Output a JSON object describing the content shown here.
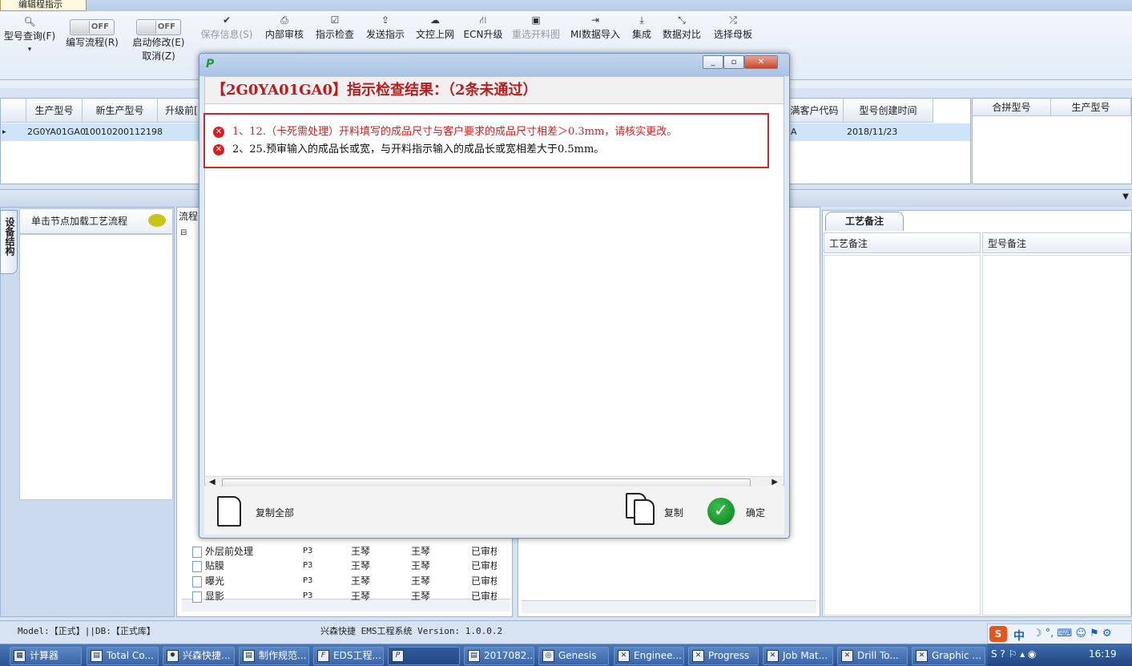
{
  "doc_tab": {
    "label": "编辑程指示"
  },
  "toolbar": {
    "search": {
      "icon": "search-icon",
      "label": "型号查询(F)"
    },
    "edit_flow": {
      "toggle": "OFF",
      "label": "编写流程(R)"
    },
    "enable_edit": {
      "toggle": "OFF",
      "label": "启动修改(E)",
      "cancel": "取消(Z)"
    },
    "items": [
      {
        "icon": "check-icon",
        "label": "保存信息(S)",
        "disabled": true
      },
      {
        "icon": "print-icon",
        "label": "内部审核"
      },
      {
        "icon": "checkbox-icon",
        "label": "指示检查"
      },
      {
        "icon": "upload-icon",
        "label": "发送指示"
      },
      {
        "icon": "cloud-upload-icon",
        "label": "文控上网"
      },
      {
        "icon": "road-icon",
        "label": "ECN升级"
      },
      {
        "icon": "image-icon",
        "label": "重选开料图",
        "disabled": true
      },
      {
        "icon": "sign-in-icon",
        "label": "MI数据导入"
      },
      {
        "icon": "download-icon",
        "label": "集成"
      },
      {
        "icon": "compress-icon",
        "label": "数据对比"
      },
      {
        "icon": "shuffle-icon",
        "label": "选择母板"
      }
    ]
  },
  "grid": {
    "headers": [
      "生产型号",
      "新生产型号",
      "升级前[",
      "满客户代码",
      "型号创建时间"
    ],
    "row": [
      "2G0YA01GA0",
      "10010200112198",
      "",
      "A",
      "2018/11/23"
    ]
  },
  "grid2": {
    "headers": [
      "合拼型号",
      "生产型号"
    ]
  },
  "left_pane": {
    "vertical_tab": "设备结构",
    "header": "单击节点加载工艺流程"
  },
  "mid_pane": {
    "label": "流程",
    "rows": [
      {
        "name": "外层前处理",
        "code": "P3",
        "a": "王琴",
        "b": "王琴",
        "status": "已审核"
      },
      {
        "name": "贴膜",
        "code": "P3",
        "a": "王琴",
        "b": "王琴",
        "status": "已审核"
      },
      {
        "name": "曝光",
        "code": "P3",
        "a": "王琴",
        "b": "王琴",
        "status": "已审核"
      },
      {
        "name": "显影",
        "code": "P3",
        "a": "王琴",
        "b": "王琴",
        "status": "已审核"
      }
    ]
  },
  "right_pane": {
    "tab": "工艺备注",
    "col1": "工艺备注",
    "col2": "型号备注"
  },
  "dialog": {
    "header": "【2G0YA01GA0】指示检查结果：（2条未通过）",
    "errors": [
      "1、12.（卡死需处理）开料填写的成品尺寸与客户要求的成品尺寸相差＞0.3mm，请核实更改。",
      "2、25.预审输入的成品长或宽，与开料指示输入的成品长或宽相差大于0.5mm。"
    ],
    "copy_all": "复制全部",
    "copy": "复制",
    "ok": "确定"
  },
  "status": {
    "left": "Model:【正式】||DB:【正式库】",
    "center": "兴森快捷 EMS工程系统 Version: 1.0.0.2"
  },
  "taskbar": {
    "tasks": [
      "计算器",
      "Total Co...",
      "兴森快捷...",
      "制作规范...",
      "EDS工程...",
      "",
      "2017082...",
      "Genesis",
      "Enginee...",
      "Progress",
      "Job Mat...",
      "Drill To...",
      "Graphic ..."
    ],
    "ime": "中",
    "clock": "16:19"
  }
}
